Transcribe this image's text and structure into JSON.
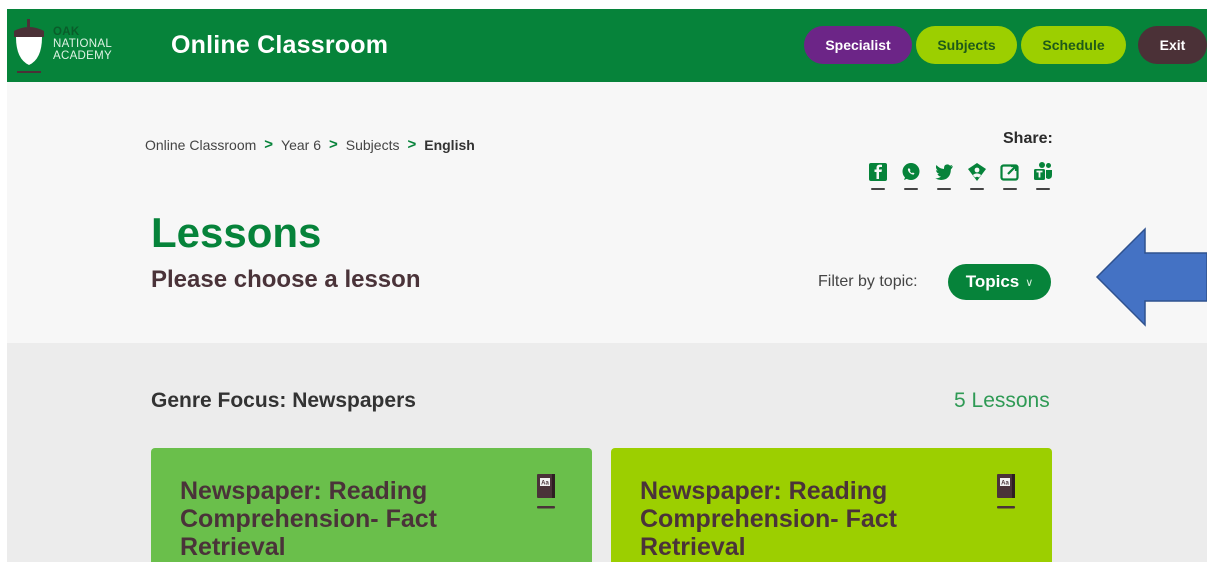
{
  "header": {
    "logo_text": [
      "OAK",
      "NATIONAL",
      "ACADEMY"
    ],
    "app_title": "Online Classroom",
    "nav": {
      "specialist": "Specialist",
      "subjects": "Subjects",
      "schedule": "Schedule",
      "exit": "Exit"
    }
  },
  "breadcrumb": {
    "items": [
      "Online Classroom",
      "Year 6",
      "Subjects"
    ],
    "current": "English",
    "separator": ">"
  },
  "share": {
    "label": "Share:",
    "icons": [
      "facebook-icon",
      "whatsapp-icon",
      "twitter-icon",
      "google-classroom-icon",
      "copy-link-icon",
      "teams-icon"
    ]
  },
  "page": {
    "title": "Lessons",
    "subtitle": "Please choose a lesson",
    "filter_label": "Filter by topic:",
    "topics_button": "Topics"
  },
  "unit": {
    "title": "Genre Focus: Newspapers",
    "count": "5 Lessons",
    "cards": [
      {
        "title": "Newspaper: Reading Comprehension- Fact Retrieval",
        "icon": "book-icon",
        "color": "#6abf4b"
      },
      {
        "title": "Newspaper: Reading Comprehension- Fact Retrieval",
        "icon": "book-icon",
        "color": "#9ccf00"
      }
    ]
  },
  "colors": {
    "brand_green": "#06833a",
    "specialist_purple": "#6c2587",
    "lime": "#9ccf00",
    "exit_brown": "#4b3137",
    "arrow_blue": "#4472c4"
  }
}
